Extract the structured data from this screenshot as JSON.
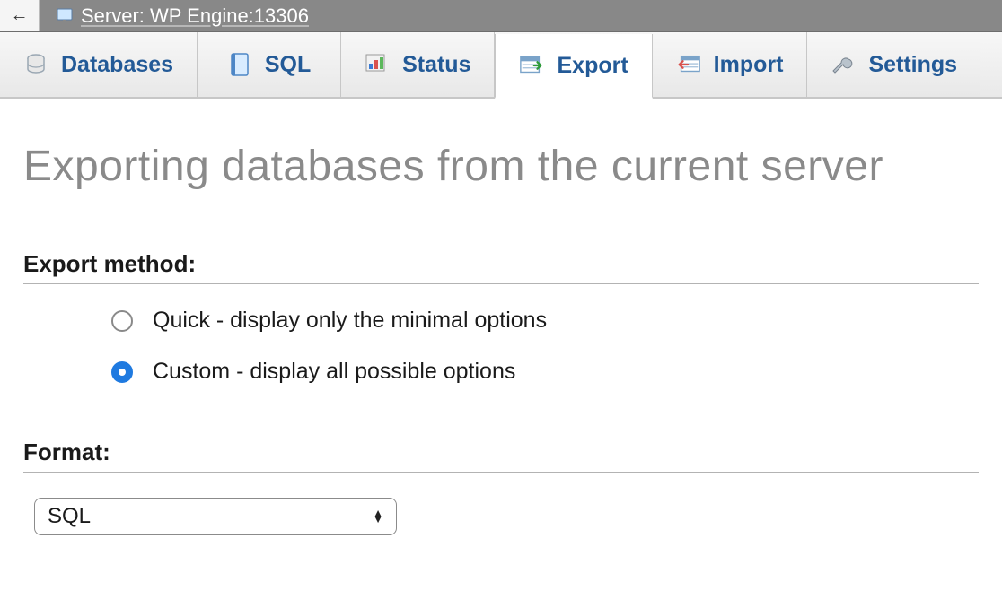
{
  "breadcrumb": {
    "label": "Server: WP Engine:13306"
  },
  "tabs": {
    "databases": "Databases",
    "sql": "SQL",
    "status": "Status",
    "export": "Export",
    "import": "Import",
    "settings": "Settings"
  },
  "page": {
    "title": "Exporting databases from the current server"
  },
  "export_method": {
    "heading": "Export method:",
    "quick": "Quick - display only the minimal options",
    "custom": "Custom - display all possible options",
    "selected": "custom"
  },
  "format": {
    "heading": "Format:",
    "selected": "SQL"
  }
}
